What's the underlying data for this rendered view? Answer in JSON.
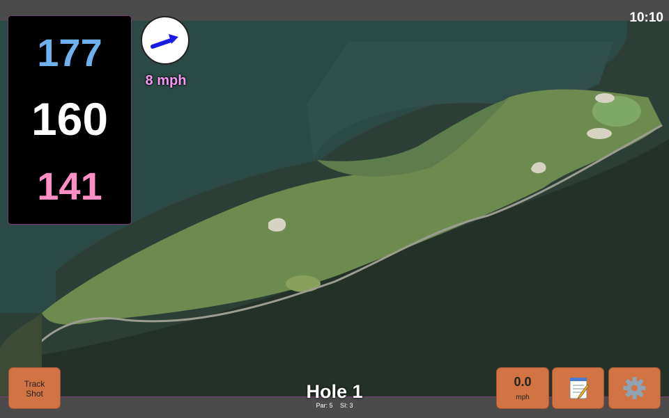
{
  "status": {
    "time": "10:10"
  },
  "distances": {
    "back": "177",
    "middle": "160",
    "front": "141"
  },
  "wind": {
    "speed_label": "8 mph",
    "icon": "wind-arrow-icon"
  },
  "hole": {
    "title": "Hole 1",
    "par": "Par: 5",
    "si": "SI: 3"
  },
  "buttons": {
    "track_shot_line1": "Track",
    "track_shot_line2": "Shot",
    "speed_value": "0.0",
    "speed_unit": "mph",
    "notes_icon": "notepad-icon",
    "settings_icon": "gear-icon"
  },
  "colors": {
    "back_distance": "#6fb0ee",
    "middle_distance": "#ffffff",
    "front_distance": "#ff8fc4",
    "wind_label": "#f39af0",
    "button": "#d27344"
  }
}
